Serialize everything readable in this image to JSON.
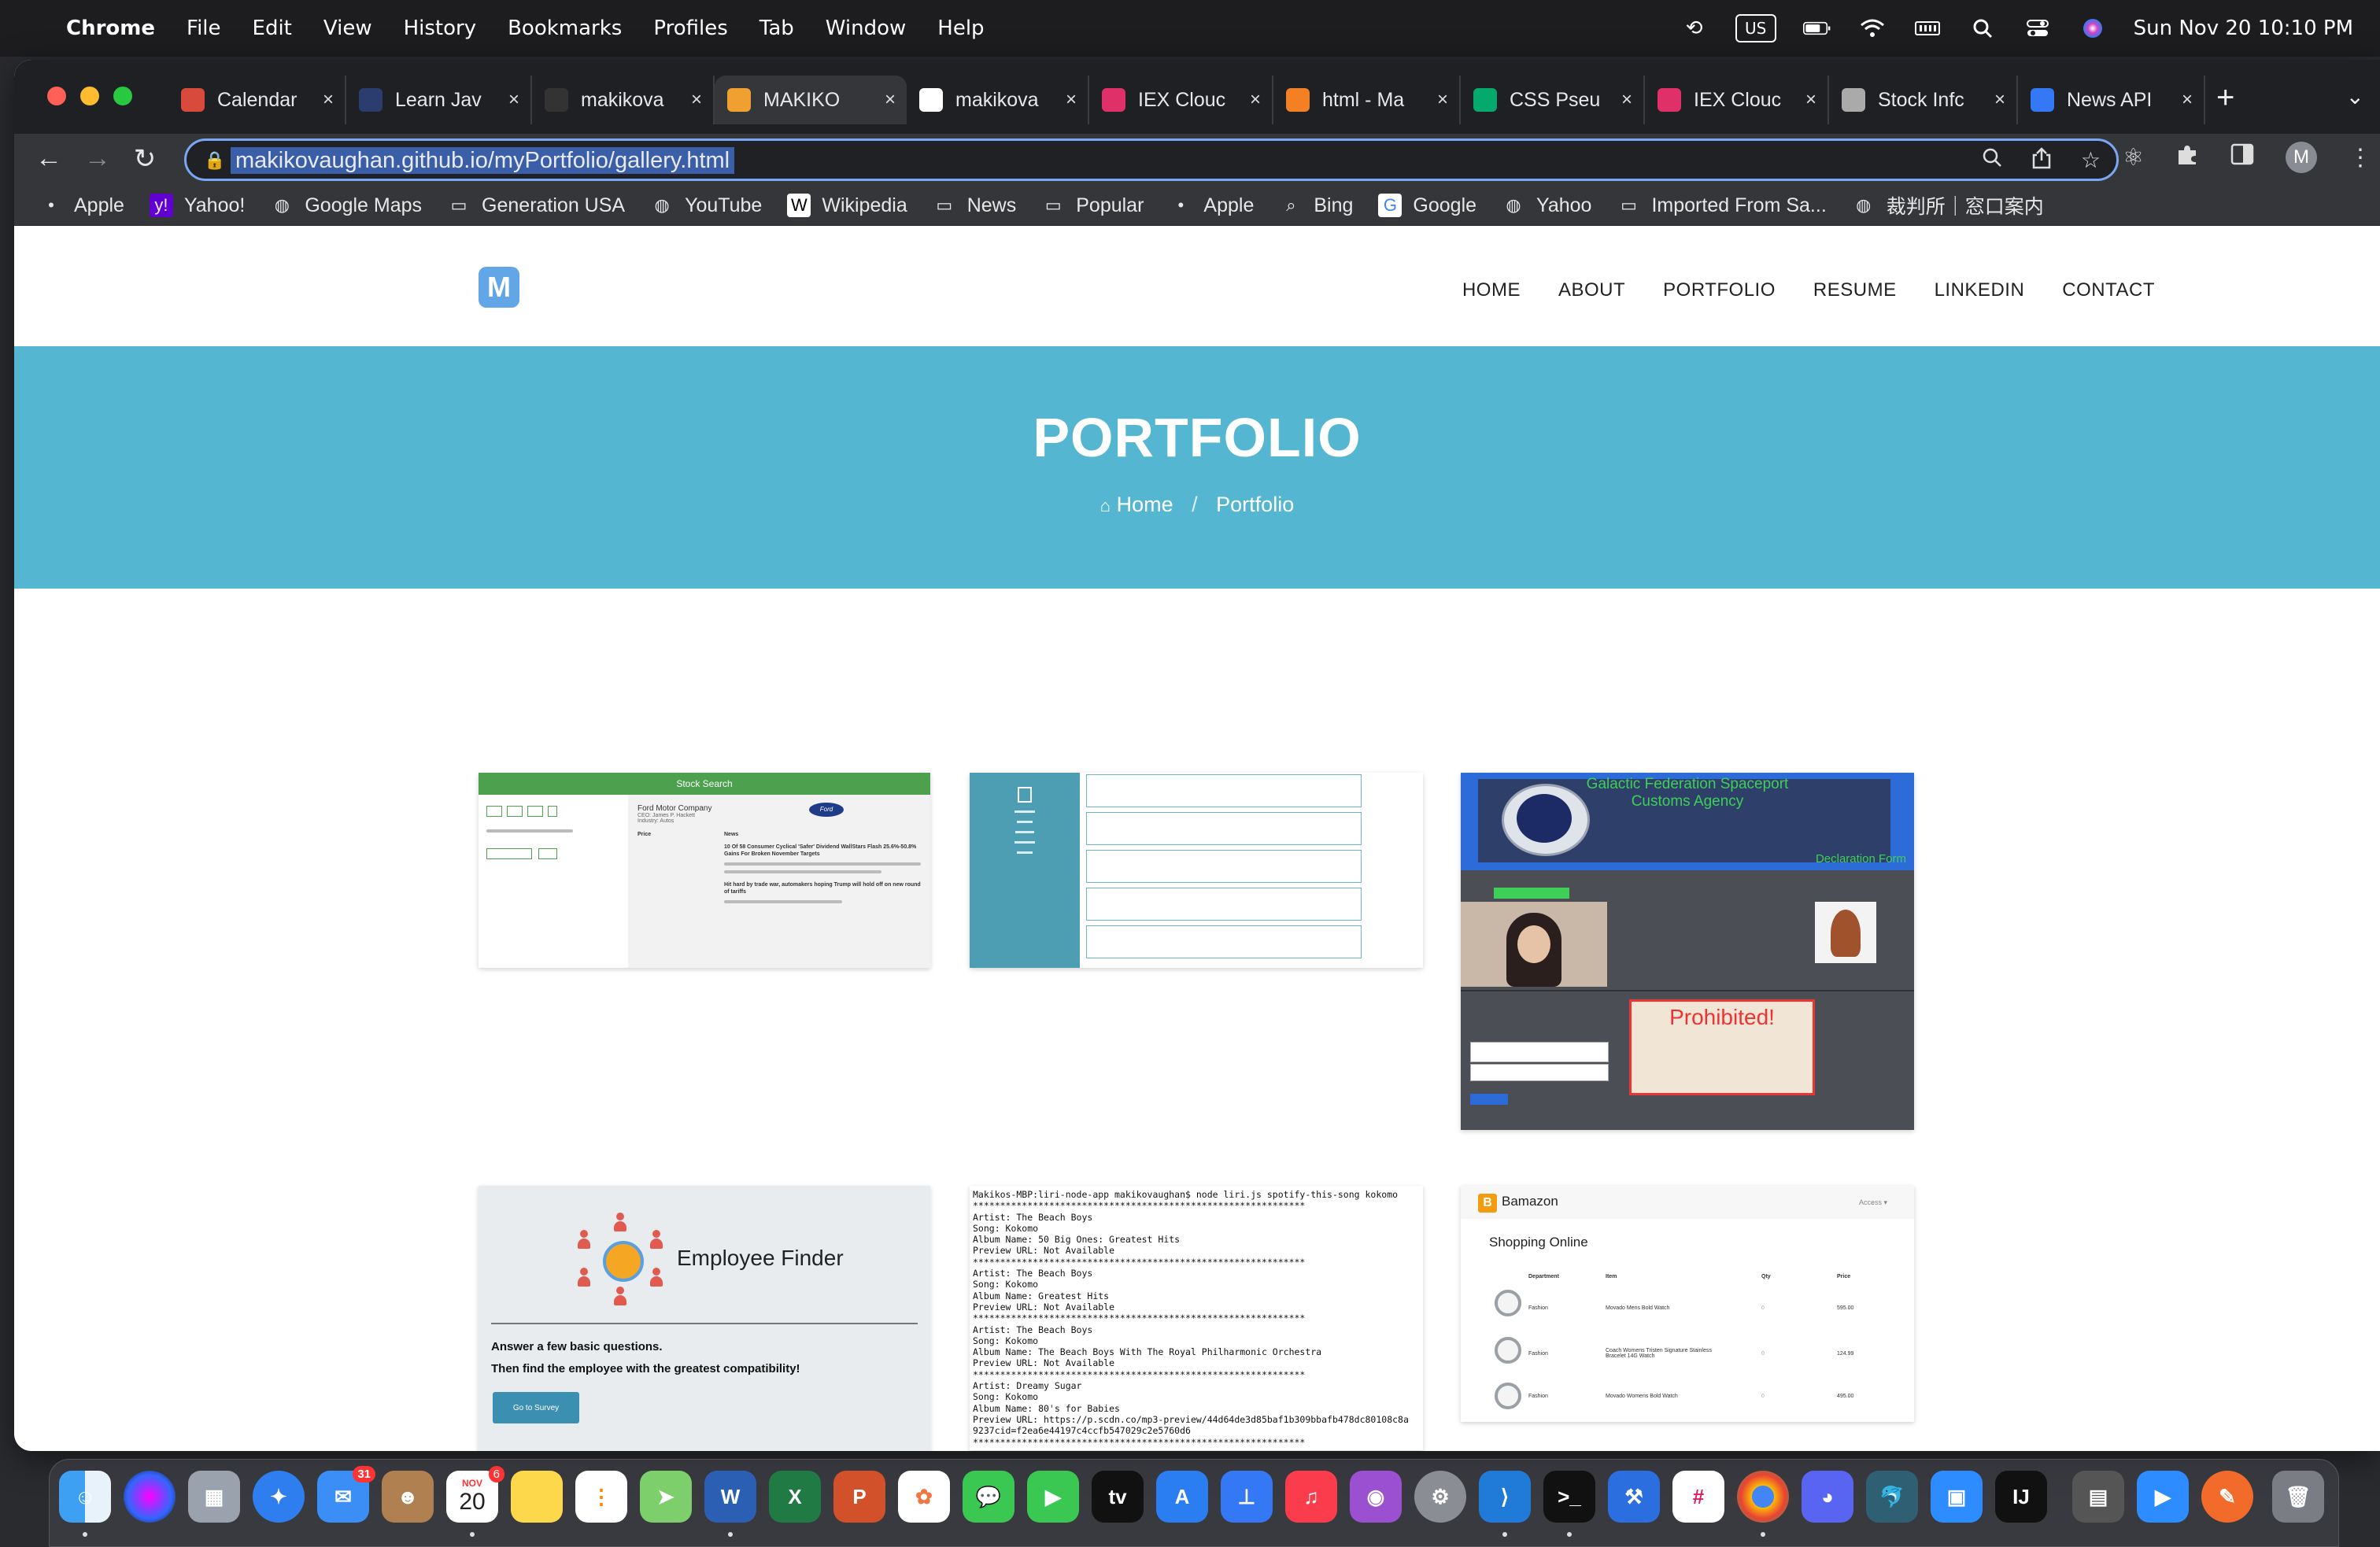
{
  "menubar": {
    "app": "Chrome",
    "menus": [
      "File",
      "Edit",
      "View",
      "History",
      "Bookmarks",
      "Profiles",
      "Tab",
      "Window",
      "Help"
    ],
    "input_source": "US",
    "datetime": "Sun Nov 20  10:10 PM"
  },
  "tabs": [
    {
      "title": "Calendar",
      "color": "#d84a3c"
    },
    {
      "title": "Learn Jav",
      "color": "#2b3c6e"
    },
    {
      "title": "makikova",
      "color": "#333333"
    },
    {
      "title": "MAKIKO",
      "color": "#f0a030"
    },
    {
      "title": "makikova",
      "color": "#ffffff"
    },
    {
      "title": "IEX Clouc",
      "color": "#e0306a"
    },
    {
      "title": "html - Ma",
      "color": "#f48024"
    },
    {
      "title": "CSS Pseu",
      "color": "#04aa6d"
    },
    {
      "title": "IEX Clouc",
      "color": "#e0306a"
    },
    {
      "title": "Stock Infc",
      "color": "#aaaaaa"
    },
    {
      "title": "News API",
      "color": "#3478f6"
    }
  ],
  "address_bar": {
    "url": "makikovaughan.github.io/myPortfolio/gallery.html"
  },
  "profile_initial": "M",
  "bookmarks": [
    {
      "label": "Apple",
      "icon": "apple-icon"
    },
    {
      "label": "Yahoo!",
      "icon": "yahoo-icon"
    },
    {
      "label": "Google Maps",
      "icon": "globe-icon"
    },
    {
      "label": "Generation USA",
      "icon": "folder-icon"
    },
    {
      "label": "YouTube",
      "icon": "globe-icon"
    },
    {
      "label": "Wikipedia",
      "icon": "wikipedia-icon"
    },
    {
      "label": "News",
      "icon": "folder-icon"
    },
    {
      "label": "Popular",
      "icon": "folder-icon"
    },
    {
      "label": "Apple",
      "icon": "apple-icon"
    },
    {
      "label": "Bing",
      "icon": "search-icon"
    },
    {
      "label": "Google",
      "icon": "google-icon"
    },
    {
      "label": "Yahoo",
      "icon": "globe-icon"
    },
    {
      "label": "Imported From Sa...",
      "icon": "folder-icon"
    },
    {
      "label": "裁判所｜窓口案内",
      "icon": "globe-icon"
    }
  ],
  "site": {
    "logo": "M",
    "nav": [
      "HOME",
      "ABOUT",
      "PORTFOLIO",
      "RESUME",
      "LINKEDIN",
      "CONTACT"
    ],
    "hero_title": "PORTFOLIO",
    "breadcrumb_home": "Home",
    "breadcrumb_current": "Portfolio",
    "accent": "#55b6d1"
  },
  "gallery": {
    "stock": {
      "header": "Stock Search",
      "company": "Ford Motor Company",
      "ceo": "CEO: James P. Hackett",
      "industry": "Industry: Autos",
      "price_label": "Price",
      "news_label": "News",
      "headline1": "10 Of 58 Consumer Cyclical 'Safer' Dividend WallStars Flash 25.6%-50.8% Gains For Broken November Targets",
      "headline2": "Hit hard by trade war, automakers hoping Trump will hold off on new round of tariffs"
    },
    "galactic": {
      "title_line1": "Galactic Federation Spaceport",
      "title_line2": "Customs Agency",
      "form": "Declaration Form",
      "prohibited": "Prohibited!"
    },
    "employee": {
      "title": "Employee Finder",
      "line1": "Answer a few basic questions.",
      "line2": "Then find the employee with the greatest compatibility!",
      "button": "Go to Survey"
    },
    "terminal": {
      "lines": [
        "Makikos-MBP:liri-node-app makikovaughan$ node liri.js spotify-this-song kokomo",
        "*************************************************************",
        "Artist: The Beach Boys",
        "Song: Kokomo",
        "Album Name: 50 Big Ones: Greatest Hits",
        "Preview URL: Not Available",
        "*************************************************************",
        "Artist: The Beach Boys",
        "Song: Kokomo",
        "Album Name: Greatest Hits",
        "Preview URL: Not Available",
        "*************************************************************",
        "Artist: The Beach Boys",
        "Song: Kokomo",
        "Album Name: The Beach Boys With The Royal Philharmonic Orchestra",
        "Preview URL: Not Available",
        "*************************************************************",
        "Artist: Dreamy Sugar",
        "Song: Kokomo",
        "Album Name: 80's for Babies",
        "Preview URL: https://p.scdn.co/mp3-preview/44d64de3d85baf1b309bbafb478dc80108c8a",
        "9237cid=f2ea6e44197c4ccfb547029c2e5760d6",
        "*************************************************************"
      ]
    },
    "bamazon": {
      "brand": "Bamazon",
      "access": "Access ▾",
      "heading": "Shopping Online",
      "columns": [
        "Department",
        "Item",
        "Qty",
        "Price"
      ],
      "rows": [
        {
          "dept": "Fashion",
          "item": "Movado Mens Bold Watch",
          "qty": "0",
          "price": "595.00"
        },
        {
          "dept": "Fashion",
          "item": "Coach Womens Tristen Signature Stainless Bracelet 14G Watch",
          "qty": "0",
          "price": "124.99"
        },
        {
          "dept": "Fashion",
          "item": "Movado Womens Bold Watch",
          "qty": "0",
          "price": "495.00"
        }
      ]
    }
  },
  "dock": {
    "calendar_month": "NOV",
    "calendar_day": "20",
    "mail_badge": "31",
    "calendar_badge": "6"
  }
}
